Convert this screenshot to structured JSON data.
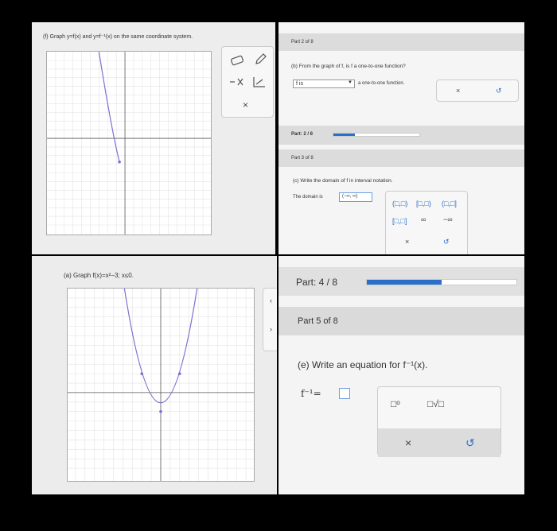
{
  "panel_f": {
    "prompt": "(f) Graph y=f(x) and y=f⁻¹(x) on the same coordinate system.",
    "close": "×"
  },
  "panel_b": {
    "part_label": "Part 2 of 8",
    "question": "(b) From the graph of f, is f a one-to-one function?",
    "select_value": "f is",
    "answer_tail": "a one-to-one function.",
    "close": "×",
    "undo": "↺",
    "progress_label": "Part: 2 / 8",
    "progress": 0.25
  },
  "panel_c": {
    "part_label": "Part 3 of 8",
    "question": "(c) Write the domain of f in interval notation.",
    "domain_label": "The domain is",
    "domain_value": "(−∞, ∞)",
    "sym_oo": "(□,□)",
    "sym_co": "[□,□)",
    "sym_oc": "(□,□]",
    "sym_cc": "[□,□]",
    "sym_inf": "∞",
    "sym_ninf": "−∞",
    "close": "×",
    "undo": "↺"
  },
  "panel_a": {
    "prompt": "(a) Graph f(x)=x²−3; x≤0."
  },
  "panel_e": {
    "progress_label": "Part: 4 / 8",
    "progress": 0.5,
    "part_label": "Part 5 of 8",
    "question": "(e) Write an equation for f⁻¹(x).",
    "eq_prefix": "f⁻¹=",
    "tool_power": "□ᵒ",
    "tool_root": "□√□",
    "close": "×",
    "undo": "↺"
  },
  "colors": {
    "accent": "#2a6fc9",
    "curve": "#7a6fcf"
  }
}
